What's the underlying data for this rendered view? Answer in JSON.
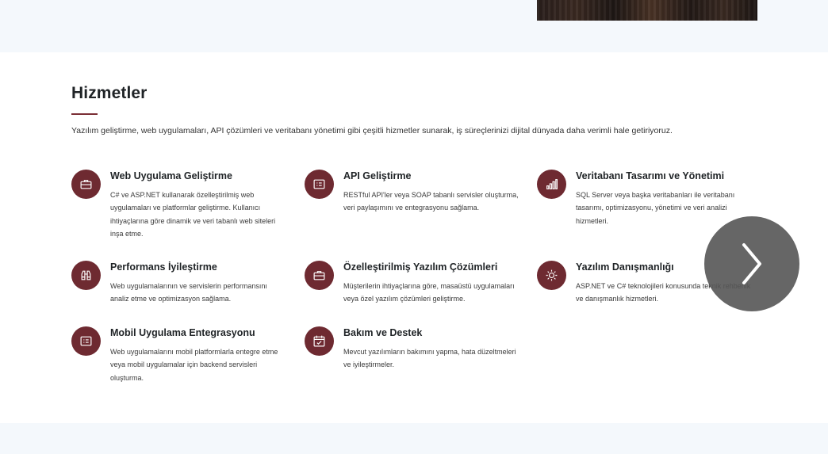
{
  "services_section": {
    "title": "Hizmetler",
    "description": "Yazılım geliştirme, web uygulamaları, API çözümleri ve veritabanı yönetimi gibi çeşitli hizmetler sunarak, iş süreçlerinizi dijital dünyada daha verimli hale getiriyoruz.",
    "items": [
      {
        "title": "Web Uygulama Geliştirme",
        "description": "C# ve ASP.NET kullanarak özelleştirilmiş web uygulamaları ve platformlar geliştirme. Kullanıcı ihtiyaçlarına göre dinamik ve veri tabanlı web siteleri inşa etme.",
        "icon": "briefcase-icon"
      },
      {
        "title": "API Geliştirme",
        "description": "RESTful API'ler veya SOAP tabanlı servisler oluşturma, veri paylaşımını ve entegrasyonu sağlama.",
        "icon": "card-list-icon"
      },
      {
        "title": "Veritabanı Tasarımı ve Yönetimi",
        "description": "SQL Server veya başka veritabanları ile veritabanı tasarımı, optimizasyonu, yönetimi ve veri analizi hizmetleri.",
        "icon": "bar-chart-icon"
      },
      {
        "title": "Performans İyileştirme",
        "description": "Web uygulamalarının ve servislerin performansını analiz etme ve optimizasyon sağlama.",
        "icon": "binoculars-icon"
      },
      {
        "title": "Özelleştirilmiş Yazılım Çözümleri",
        "description": "Müşterilerin ihtiyaçlarına göre, masaüstü uygulamaları veya özel yazılım çözümleri geliştirme.",
        "icon": "briefcase-icon"
      },
      {
        "title": "Yazılım Danışmanlığı",
        "description": "ASP.NET ve C# teknolojileri konusunda teknik rehberlik ve danışmanlık hizmetleri.",
        "icon": "sun-icon"
      },
      {
        "title": "Mobil Uygulama Entegrasyonu",
        "description": "Web uygulamalarını mobil platformlarla entegre etme veya mobil uygulamalar için backend servisleri oluşturma.",
        "icon": "card-list-icon"
      },
      {
        "title": "Bakım ve Destek",
        "description": "Mevcut yazılımların bakımını yapma, hata düzeltmeleri ve iyileştirmeler.",
        "icon": "calendar-check-icon"
      }
    ]
  },
  "carousel": {
    "next_icon": "chevron-right-icon"
  },
  "colors": {
    "accent": "#6e2a31",
    "section_bg": "#ffffff",
    "page_bg": "#f4f8fc"
  }
}
